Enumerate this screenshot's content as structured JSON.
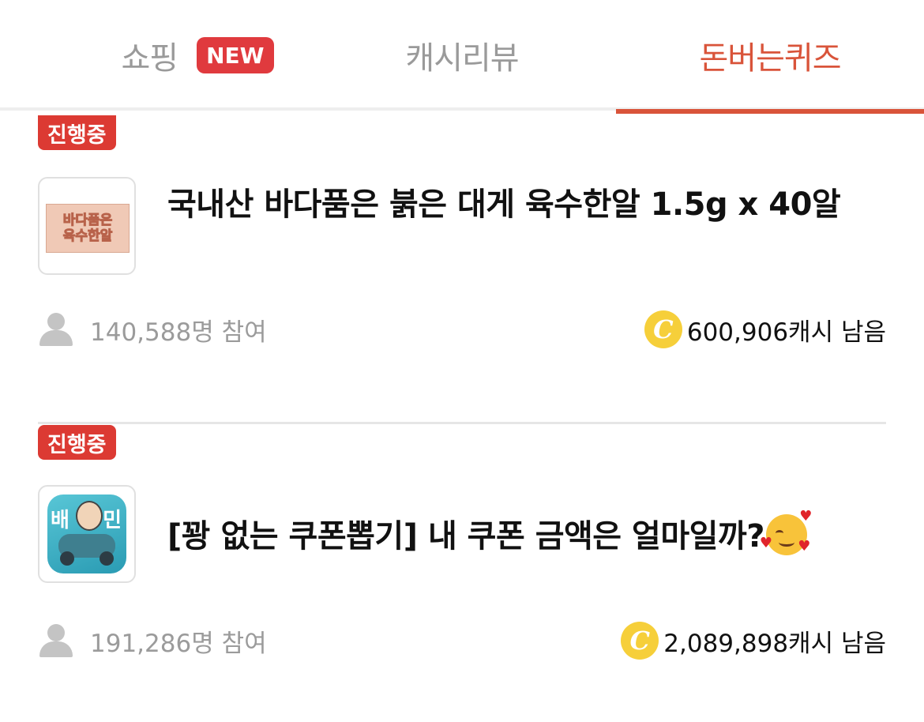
{
  "tabs": {
    "shopping": "쇼핑",
    "new_badge": "NEW",
    "review": "캐시리뷰",
    "quiz": "돈버는퀴즈"
  },
  "quizzes": [
    {
      "status": "진행중",
      "thumb_text_1": "바다품은",
      "thumb_text_2": "육수한알",
      "title": "국내산 바다품은 붉은 대게 육수한알 1.5g x 40알",
      "participants": "140,588명 참여",
      "coin_symbol": "C",
      "remaining": "600,906캐시 남음"
    },
    {
      "status": "진행중",
      "thumb_text_left": "배",
      "thumb_text_right": "민",
      "title": "[꽝 없는 쿠폰뽑기] 내 쿠폰 금액은 얼마일까?",
      "title_emoji": "smiling-face-with-hearts",
      "participants": "191,286명 참여",
      "coin_symbol": "C",
      "remaining": "2,089,898캐시 남음"
    }
  ],
  "colors": {
    "accent": "#d9543a",
    "badge": "#e03a3e",
    "coin": "#f6cf3a"
  }
}
